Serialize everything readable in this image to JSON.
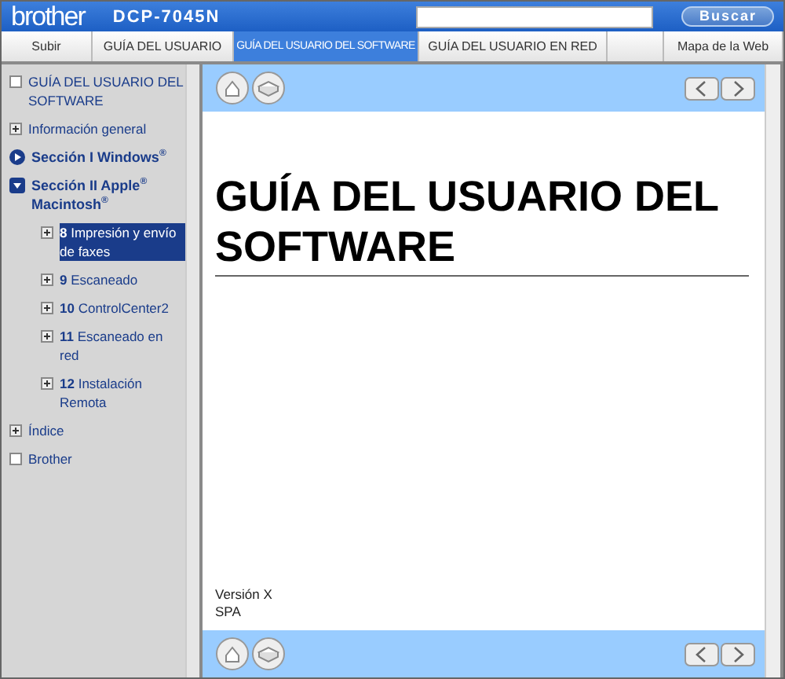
{
  "header": {
    "logo": "brother",
    "model": "DCP-7045N",
    "search_button": "Buscar"
  },
  "nav": [
    {
      "label": "Subir",
      "selected": false
    },
    {
      "label": "GUÍA DEL USUARIO",
      "selected": false
    },
    {
      "label": "GUÍA DEL USUARIO DEL SOFTWARE",
      "selected": true
    },
    {
      "label": "GUÍA DEL USUARIO EN RED",
      "selected": false
    }
  ],
  "site_map": "Mapa de la Web",
  "sidebar": {
    "items": [
      {
        "kind": "page",
        "label": "GUÍA DEL USUARIO DEL SOFTWARE",
        "selected": false
      },
      {
        "kind": "folder",
        "label": "Información general",
        "expanded": false,
        "selected": false
      },
      {
        "kind": "section",
        "label": "Sección I Windows$^{®}$",
        "expanded": false,
        "selected": false
      },
      {
        "kind": "section",
        "label": "Sección II Apple$^{®}$ Macintosh$^{®}$",
        "expanded": true,
        "selected": false,
        "children": [
          {
            "kind": "folder",
            "label": "**8** Impresión y envío de faxes",
            "expanded": false,
            "selected": true
          },
          {
            "kind": "folder",
            "label": "**9** Escaneado",
            "expanded": false,
            "selected": false
          },
          {
            "kind": "folder",
            "label": "**10** ControlCenter2",
            "expanded": false,
            "selected": false
          },
          {
            "kind": "folder",
            "label": "**11** Escaneado en red",
            "expanded": false,
            "selected": false
          },
          {
            "kind": "folder",
            "label": "**12** Instalación Remota",
            "expanded": false,
            "selected": false
          }
        ]
      },
      {
        "kind": "folder",
        "label": "Índice",
        "expanded": false,
        "selected": false
      },
      {
        "kind": "page",
        "label": "Brother",
        "selected": false
      }
    ]
  },
  "content": {
    "title": "GUÍA DEL USUARIO DEL SOFTWARE",
    "version": "Versión X",
    "language": "SPA"
  }
}
